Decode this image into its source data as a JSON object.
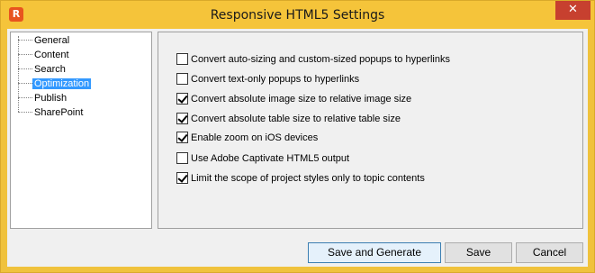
{
  "window": {
    "title": "Responsive HTML5 Settings",
    "app_icon_letter": "R",
    "close_glyph": "✕"
  },
  "tree": {
    "items": [
      {
        "label": "General",
        "selected": false
      },
      {
        "label": "Content",
        "selected": false
      },
      {
        "label": "Search",
        "selected": false
      },
      {
        "label": "Optimization",
        "selected": true
      },
      {
        "label": "Publish",
        "selected": false
      },
      {
        "label": "SharePoint",
        "selected": false
      }
    ]
  },
  "options": [
    {
      "label": "Convert auto-sizing and custom-sized popups to hyperlinks",
      "checked": false
    },
    {
      "label": "Convert text-only popups to hyperlinks",
      "checked": false
    },
    {
      "label": "Convert absolute image size to relative image size",
      "checked": true
    },
    {
      "label": "Convert absolute table size to relative table size",
      "checked": true
    },
    {
      "label": "Enable zoom on iOS devices",
      "checked": true
    },
    {
      "label": "Use Adobe Captivate HTML5 output",
      "checked": false
    },
    {
      "label": "Limit the scope of project styles only to topic contents",
      "checked": true
    }
  ],
  "buttons": {
    "save_and_generate": "Save and Generate",
    "save": "Save",
    "cancel": "Cancel"
  }
}
